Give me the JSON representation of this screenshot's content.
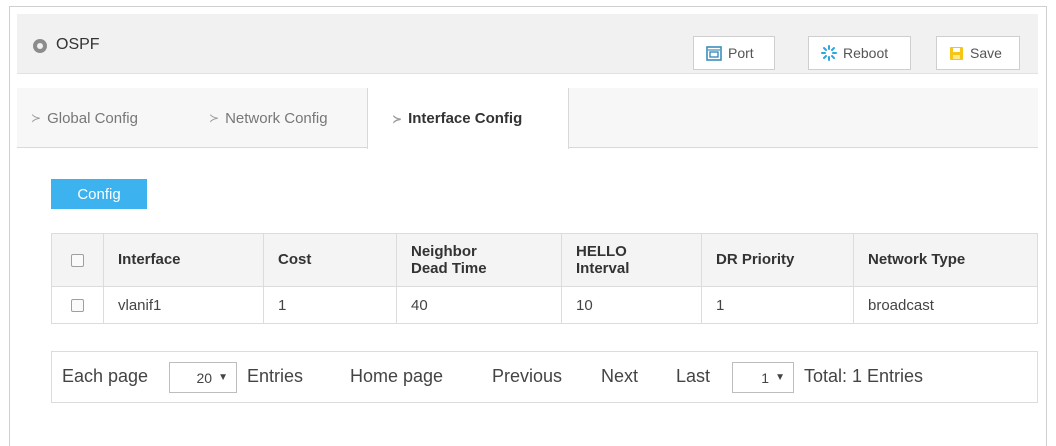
{
  "header": {
    "title": "OSPF",
    "port_label": "Port",
    "reboot_label": "Reboot",
    "save_label": "Save"
  },
  "tabs": [
    {
      "label": "Global Config",
      "active": false
    },
    {
      "label": "Network Config",
      "active": false
    },
    {
      "label": "Interface Config",
      "active": true
    }
  ],
  "config_button": "Config",
  "table": {
    "columns": [
      "Interface",
      "Cost",
      "Neighbor Dead Time",
      "HELLO Interval",
      "DR Priority",
      "Network Type"
    ],
    "rows": [
      {
        "interface": "vlanif1",
        "cost": "1",
        "dead_time": "40",
        "hello": "10",
        "dr_priority": "1",
        "network_type": "broadcast"
      }
    ]
  },
  "pager": {
    "each_page": "Each page",
    "page_size": "20",
    "entries": "Entries",
    "home": "Home page",
    "previous": "Previous",
    "next": "Next",
    "last": "Last",
    "current_page": "1",
    "total": "Total: 1 Entries"
  },
  "colors": {
    "accent": "#3cb2ef",
    "header_bg": "#f1f1f1",
    "save_icon": "#f5c518",
    "port_icon": "#3c8dbc",
    "reboot_icon": "#2aa7e0"
  }
}
